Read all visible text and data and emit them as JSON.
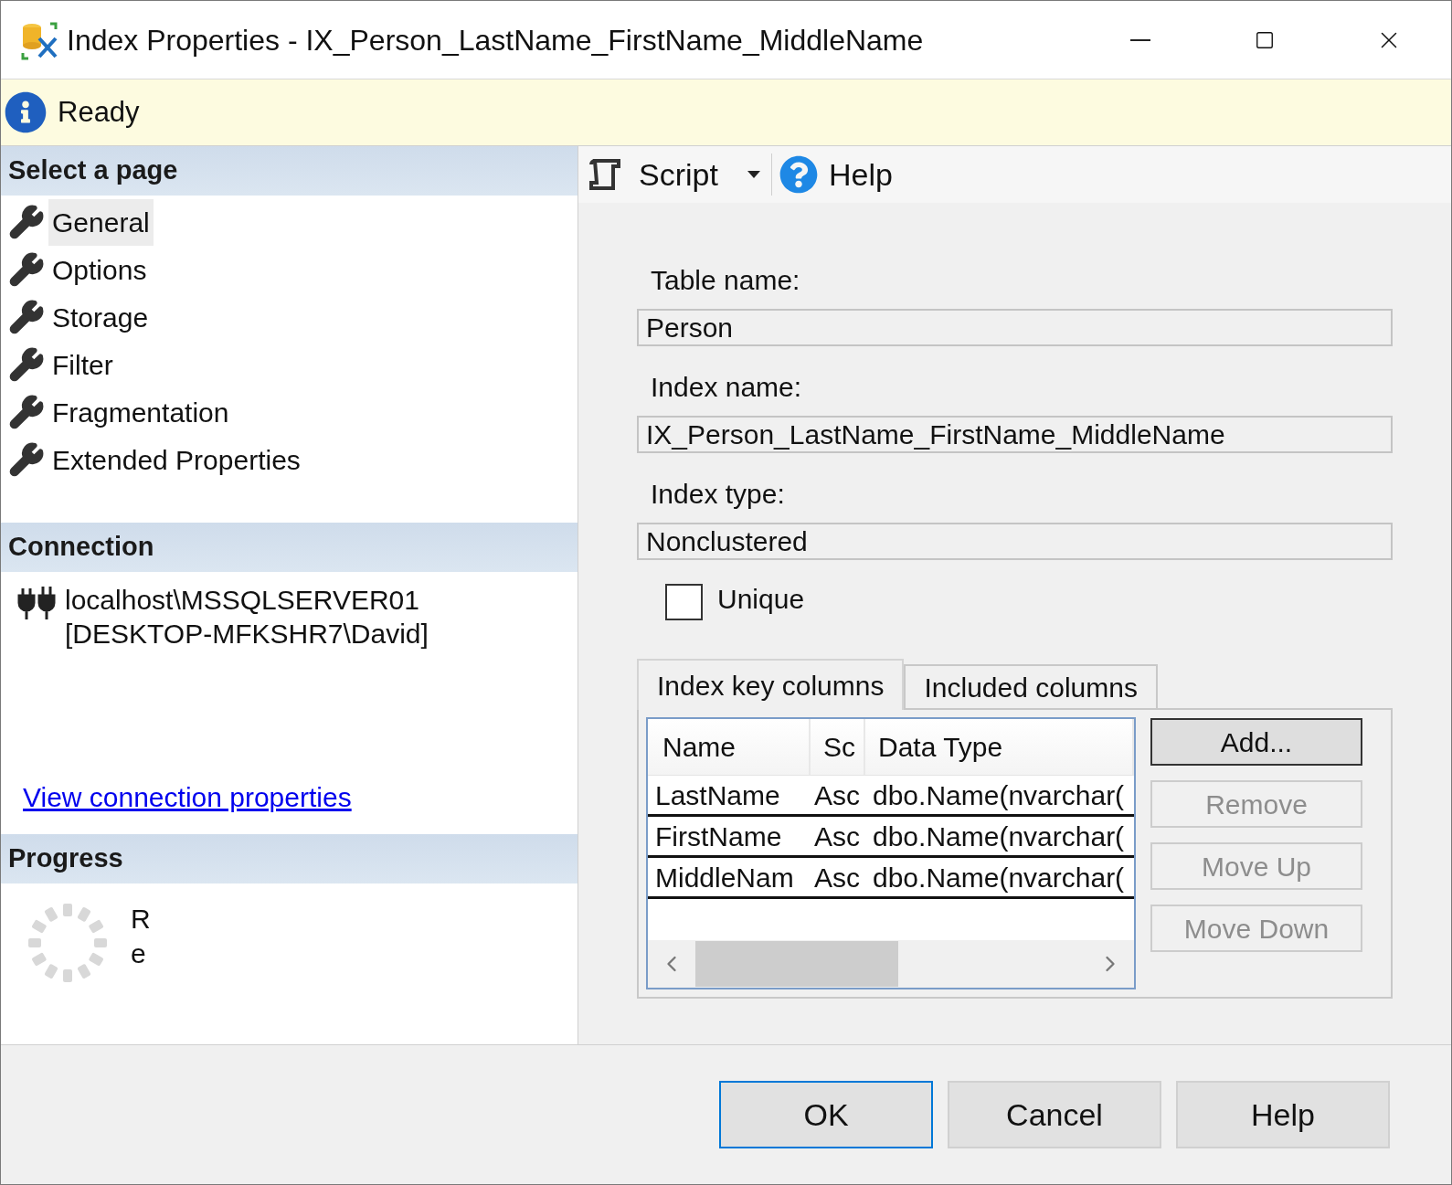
{
  "window": {
    "title": "Index Properties - IX_Person_LastName_FirstName_MiddleName"
  },
  "status": {
    "text": "Ready"
  },
  "select_page": {
    "title": "Select a page",
    "items": [
      {
        "label": "General",
        "selected": true
      },
      {
        "label": "Options",
        "selected": false
      },
      {
        "label": "Storage",
        "selected": false
      },
      {
        "label": "Filter",
        "selected": false
      },
      {
        "label": "Fragmentation",
        "selected": false
      },
      {
        "label": "Extended Properties",
        "selected": false
      }
    ]
  },
  "connection": {
    "title": "Connection",
    "lines": [
      "localhost\\MSSQLSERVER01",
      "[DESKTOP-MFKSHR7\\David]"
    ],
    "link": "View connection properties"
  },
  "progress": {
    "title": "Progress",
    "status_lines": [
      "R",
      "e"
    ]
  },
  "toolbar": {
    "items": [
      {
        "label": "Script",
        "kind": "script"
      },
      {
        "label": "Help",
        "kind": "help"
      }
    ]
  },
  "fields": [
    {
      "label": "Table name:",
      "value": "Person"
    },
    {
      "label": "Index name:",
      "value": "IX_Person_LastName_FirstName_MiddleName"
    },
    {
      "label": "Index type:",
      "value": "Nonclustered"
    }
  ],
  "unique": {
    "label": "Unique",
    "checked": false
  },
  "tabs": [
    {
      "label": "Index key columns",
      "selected": true
    },
    {
      "label": "Included columns",
      "selected": false
    }
  ],
  "table": {
    "columns": [
      "Name",
      "Sc",
      "Data Type"
    ],
    "rows": [
      [
        "LastName",
        "Asc",
        "dbo.Name(nvarchar("
      ],
      [
        "FirstName",
        "Asc",
        "dbo.Name(nvarchar("
      ],
      [
        "MiddleNam",
        "Asc",
        "dbo.Name(nvarchar("
      ]
    ]
  },
  "side_buttons": [
    {
      "label": "Add...",
      "disabled": false
    },
    {
      "label": "Remove",
      "disabled": true
    },
    {
      "label": "Move Up",
      "disabled": true
    },
    {
      "label": "Move Down",
      "disabled": true
    }
  ],
  "footer_buttons": [
    {
      "label": "OK",
      "default": true
    },
    {
      "label": "Cancel",
      "default": false
    },
    {
      "label": "Help",
      "default": false
    }
  ]
}
